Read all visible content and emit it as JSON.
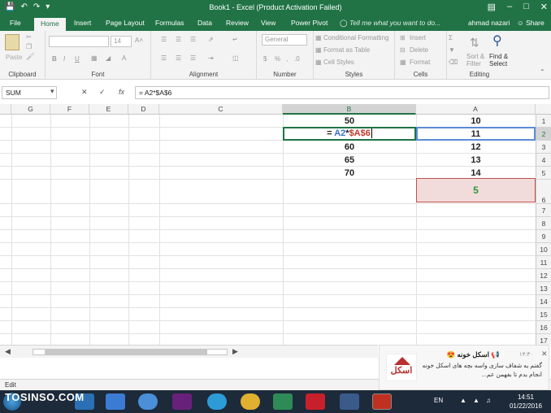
{
  "titlebar": {
    "title": "Book1 - Excel (Product Activation Failed)",
    "controls": [
      "–",
      "□",
      "✕"
    ]
  },
  "tabs": {
    "file": "File",
    "home": "Home",
    "insert": "Insert",
    "page_layout": "Page Layout",
    "formulas": "Formulas",
    "data": "Data",
    "review": "Review",
    "view": "View",
    "power_pivot": "Power Pivot",
    "tell_me": "Tell me what you want to do...",
    "user": "ahmad nazari",
    "share": "Share"
  },
  "ribbon": {
    "clipboard": {
      "label": "Clipboard",
      "paste": "Paste"
    },
    "font": {
      "label": "Font",
      "size": "14",
      "bold": "B",
      "italic": "I",
      "underline": "U"
    },
    "alignment": {
      "label": "Alignment"
    },
    "number": {
      "label": "Number",
      "format": "General"
    },
    "styles": {
      "label": "Styles",
      "conditional_formatting": "Conditional Formatting",
      "format_as_table": "Format as Table",
      "cell_styles": "Cell Styles"
    },
    "cells": {
      "label": "Cells",
      "insert": "Insert",
      "delete": "Delete",
      "format": "Format"
    },
    "editing": {
      "label": "Editing",
      "sort_filter": "Sort &",
      "sort_filter_2": "Filter",
      "find_select": "Find &",
      "find_select_2": "Select"
    }
  },
  "formula_bar": {
    "name_box": "SUM",
    "cancel": "✕",
    "enter": "✓",
    "fx": "fx",
    "formula": "= A2*$A$6"
  },
  "grid": {
    "columns": [
      "G",
      "F",
      "E",
      "D",
      "C",
      "B",
      "A"
    ],
    "rows": [
      "1",
      "2",
      "3",
      "4",
      "5",
      "6",
      "7",
      "8",
      "9",
      "10",
      "11",
      "12",
      "13",
      "14",
      "15",
      "16",
      "17",
      "18",
      "19",
      "20"
    ],
    "b_values": {
      "r1": "50",
      "r3": "60",
      "r4": "65",
      "r5": "70"
    },
    "a_values": {
      "r1": "10",
      "r2": "11",
      "r3": "12",
      "r4": "13",
      "r5": "14",
      "r6": "5"
    },
    "editing": {
      "eq": "= ",
      "ref1": "A2",
      "op": "*",
      "ref2": "$A$6"
    }
  },
  "statusbar": {
    "mode": "Edit"
  },
  "toast": {
    "title": "اسکل خونه 😍",
    "time": "۱۴:۳۰",
    "close": "✕",
    "message": "گفتم یه شفاف سازی واسه بچه های اسکل خونه انجام بدم تا بفهمن عم...",
    "logo_text": "اسکل"
  },
  "taskbar": {
    "watermark": "TOSINSO.COM",
    "lang": "EN",
    "time": "14:51",
    "date": "01/22/2016"
  },
  "colors": {
    "excel_green": "#217346",
    "ref_blue": "#3c6fc5",
    "ref_red": "#c0392b",
    "a6_fill": "#f2dcdb",
    "a6_text": "#2e9a3a"
  }
}
